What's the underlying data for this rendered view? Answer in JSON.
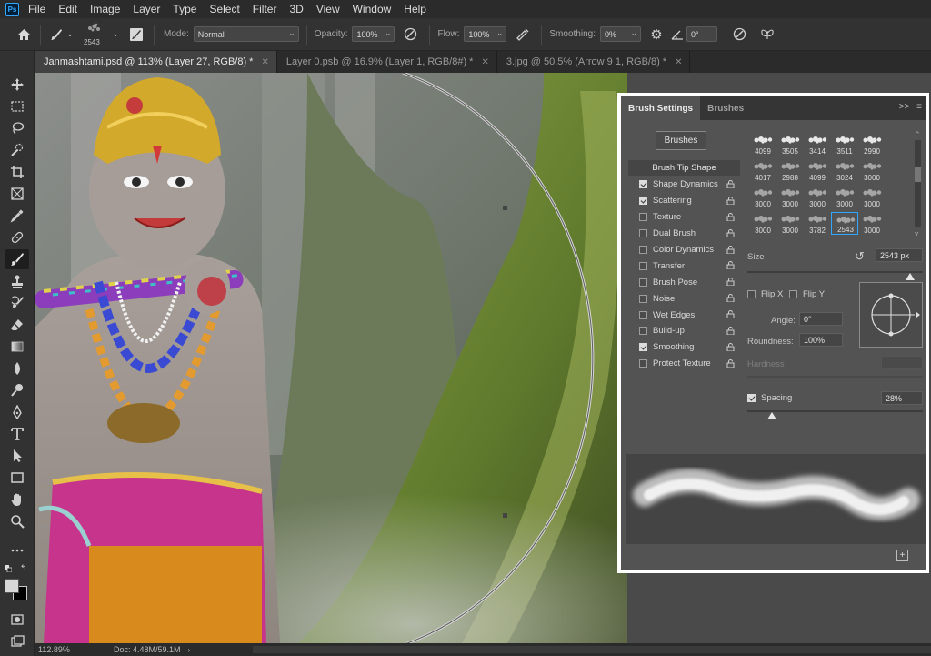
{
  "app": {
    "logo": "Ps"
  },
  "menu": [
    "File",
    "Edit",
    "Image",
    "Layer",
    "Type",
    "Select",
    "Filter",
    "3D",
    "View",
    "Window",
    "Help"
  ],
  "options_bar": {
    "brush_size": "2543",
    "mode_label": "Mode:",
    "mode_value": "Normal",
    "opacity_label": "Opacity:",
    "opacity_value": "100%",
    "flow_label": "Flow:",
    "flow_value": "100%",
    "smoothing_label": "Smoothing:",
    "smoothing_value": "0%",
    "angle_value": "0°"
  },
  "doc_tabs": [
    {
      "label": "Janmashtami.psd @ 113% (Layer 27, RGB/8) *",
      "active": true
    },
    {
      "label": "Layer 0.psb @ 16.9% (Layer 1, RGB/8#) *",
      "active": false
    },
    {
      "label": "3.jpg @ 50.5% (Arrow 9 1, RGB/8) *",
      "active": false
    }
  ],
  "status": {
    "zoom": "112.89%",
    "doc": "Doc: 4.48M/59.1M"
  },
  "brush_panel": {
    "tabs": [
      "Brush Settings",
      "Brushes"
    ],
    "collapse_icon": ">>",
    "brushes_button": "Brushes",
    "list_header": "Brush Tip Shape",
    "settings": [
      {
        "label": "Shape Dynamics",
        "checked": true
      },
      {
        "label": "Scattering",
        "checked": true
      },
      {
        "label": "Texture",
        "checked": false
      },
      {
        "label": "Dual Brush",
        "checked": false
      },
      {
        "label": "Color Dynamics",
        "checked": false
      },
      {
        "label": "Transfer",
        "checked": false
      },
      {
        "label": "Brush Pose",
        "checked": false
      },
      {
        "label": "Noise",
        "checked": false
      },
      {
        "label": "Wet Edges",
        "checked": false
      },
      {
        "label": "Build-up",
        "checked": false
      },
      {
        "label": "Smoothing",
        "checked": true
      },
      {
        "label": "Protect Texture",
        "checked": false
      }
    ],
    "tip_rows": [
      [
        "4099",
        "3505",
        "3414",
        "3511",
        "2990"
      ],
      [
        "4017",
        "2988",
        "4099",
        "3024",
        "3000"
      ],
      [
        "3000",
        "3000",
        "3000",
        "3000",
        "3000"
      ],
      [
        "3000",
        "3000",
        "3782",
        "2543",
        "3000"
      ]
    ],
    "selected_tip": "2543",
    "size_label": "Size",
    "size_value": "2543 px",
    "size_fraction": 0.93,
    "flip_x_label": "Flip X",
    "flip_y_label": "Flip Y",
    "angle_label": "Angle:",
    "angle_value": "0°",
    "roundness_label": "Roundness:",
    "roundness_value": "100%",
    "hardness_label": "Hardness",
    "spacing_label": "Spacing",
    "spacing_checked": true,
    "spacing_value": "28%",
    "spacing_fraction": 0.14
  }
}
